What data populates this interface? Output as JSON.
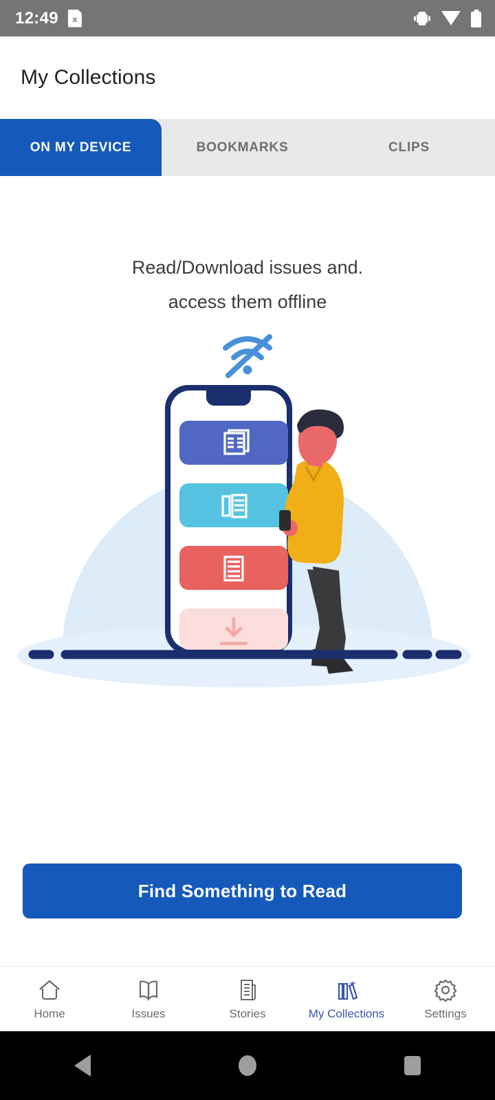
{
  "status_bar": {
    "time": "12:49",
    "sim_icon": "sim-card-x-icon",
    "sim_badge": "x",
    "vibrate_icon": "vibrate-icon",
    "wifi_icon": "wifi-full-icon",
    "battery_icon": "battery-full-icon",
    "background": "#757575"
  },
  "app_bar": {
    "title": "My Collections"
  },
  "tabs": {
    "active_index": 0,
    "items": [
      {
        "label": "ON MY DEVICE"
      },
      {
        "label": "BOOKMARKS"
      },
      {
        "label": "CLIPS"
      }
    ],
    "active_color": "#1559ba",
    "inactive_bg": "#e9e9e9"
  },
  "empty_state": {
    "line1": "Read/Download issues and.",
    "line2": "access them offline",
    "illustration_name": "offline-reading-illustration",
    "wifi_off_icon": "wifi-off-icon",
    "card_colors": [
      "#5068c4",
      "#55c3e0",
      "#e8625f",
      "#fbdedc"
    ],
    "card_icons": [
      "newspaper-icon",
      "magazine-icon",
      "article-icon",
      "download-arrow-icon"
    ],
    "backdrop_color": "#dcecf8",
    "ground_color": "#1b2e6e"
  },
  "cta": {
    "label": "Find Something to Read",
    "color": "#1559ba"
  },
  "bottom_nav": {
    "active_index": 3,
    "active_color": "#3a57a6",
    "items": [
      {
        "label": "Home",
        "icon": "home-icon"
      },
      {
        "label": "Issues",
        "icon": "open-book-icon"
      },
      {
        "label": "Stories",
        "icon": "article-document-icon"
      },
      {
        "label": "My Collections",
        "icon": "books-icon"
      },
      {
        "label": "Settings",
        "icon": "gear-icon"
      }
    ]
  },
  "android_nav": {
    "back": "back-triangle-icon",
    "home": "home-circle-icon",
    "recents": "recents-square-icon"
  }
}
